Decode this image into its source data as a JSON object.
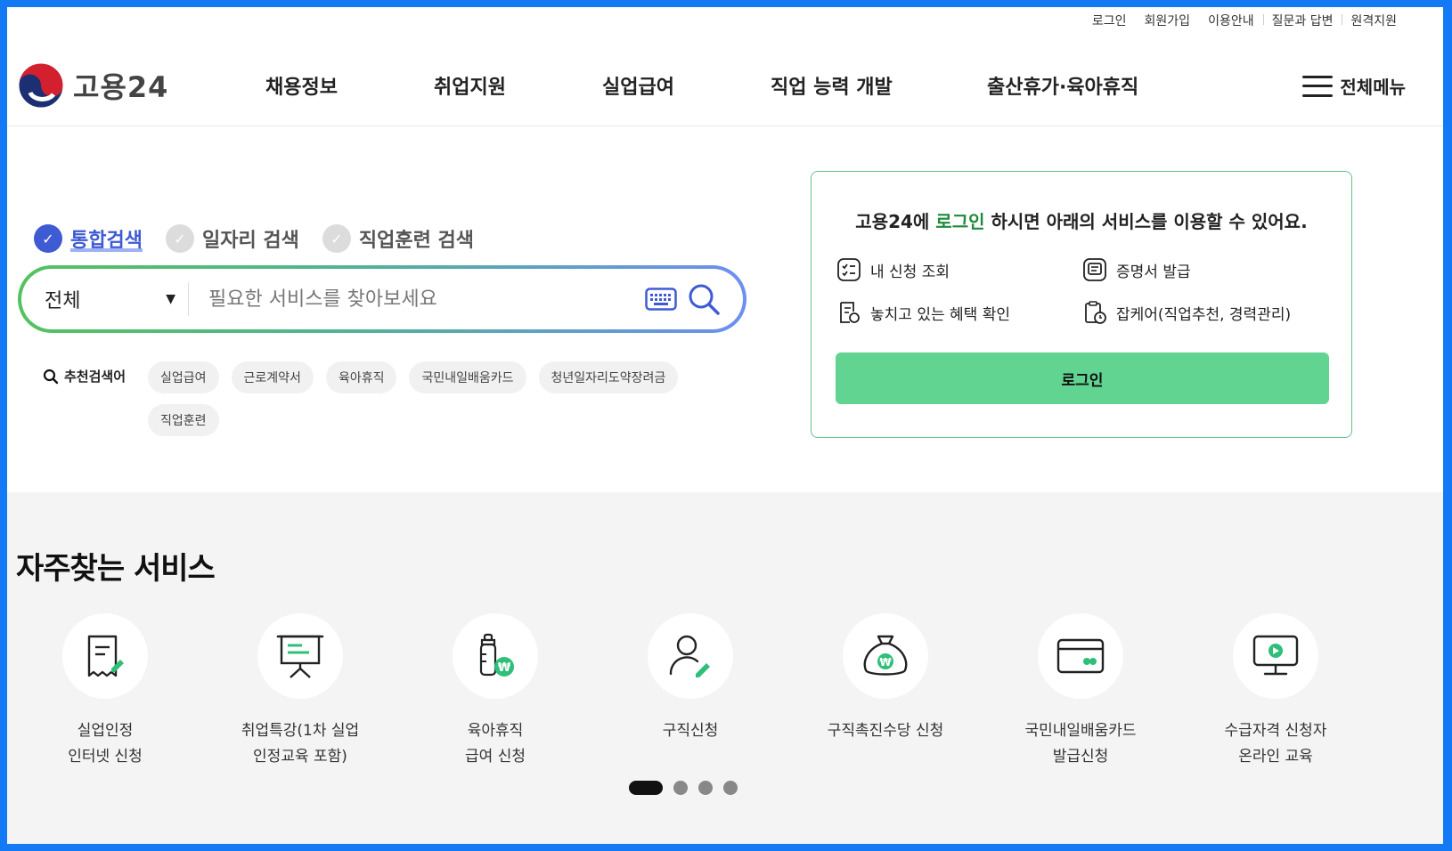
{
  "util_links": [
    "로그인",
    "회원가입",
    "이용안내",
    "질문과 답변",
    "원격지원"
  ],
  "logo": {
    "text": "고용24"
  },
  "gnb": [
    "채용정보",
    "취업지원",
    "실업급여",
    "직업 능력 개발",
    "출산휴가·육아휴직"
  ],
  "allmenu_label": "전체메뉴",
  "search": {
    "tabs": [
      {
        "label": "통합검색",
        "active": true
      },
      {
        "label": "일자리 검색",
        "active": false
      },
      {
        "label": "직업훈련 검색",
        "active": false
      }
    ],
    "category": "전체",
    "placeholder": "필요한 서비스를 찾아보세요",
    "reco_label": "추천검색어",
    "keywords": [
      "실업급여",
      "근로계약서",
      "육아휴직",
      "국민내일배움카드",
      "청년일자리도약장려금",
      "직업훈련"
    ]
  },
  "login_box": {
    "title_pre": "고용24에 ",
    "title_hl": "로그인",
    "title_post": " 하시면 아래의 서비스를 이용할 수 있어요.",
    "services": [
      "내 신청 조회",
      "증명서 발급",
      "놓치고 있는 혜택 확인",
      "잡케어(직업추천, 경력관리)"
    ],
    "button": "로그인"
  },
  "freq": {
    "title": "자주찾는 서비스",
    "items": [
      {
        "label": "실업인정\n인터넷 신청",
        "icon": "document-pen-icon"
      },
      {
        "label": "취업특강(1차 실업\n인정교육 포함)",
        "icon": "presentation-board-icon"
      },
      {
        "label": "육아휴직\n급여 신청",
        "icon": "baby-bottle-won-icon"
      },
      {
        "label": "구직신청",
        "icon": "person-pen-icon"
      },
      {
        "label": "구직촉진수당 신청",
        "icon": "money-bag-won-icon"
      },
      {
        "label": "국민내일배움카드\n발급신청",
        "icon": "credit-card-icon"
      },
      {
        "label": "수급자격 신청자\n온라인 교육",
        "icon": "monitor-play-icon"
      }
    ],
    "pagination": {
      "total": 4,
      "current": 1
    }
  },
  "colors": {
    "accent_blue": "#3e5bd4",
    "accent_green": "#60d490",
    "title_green": "#1e8a3d",
    "frame": "#1479f5"
  }
}
